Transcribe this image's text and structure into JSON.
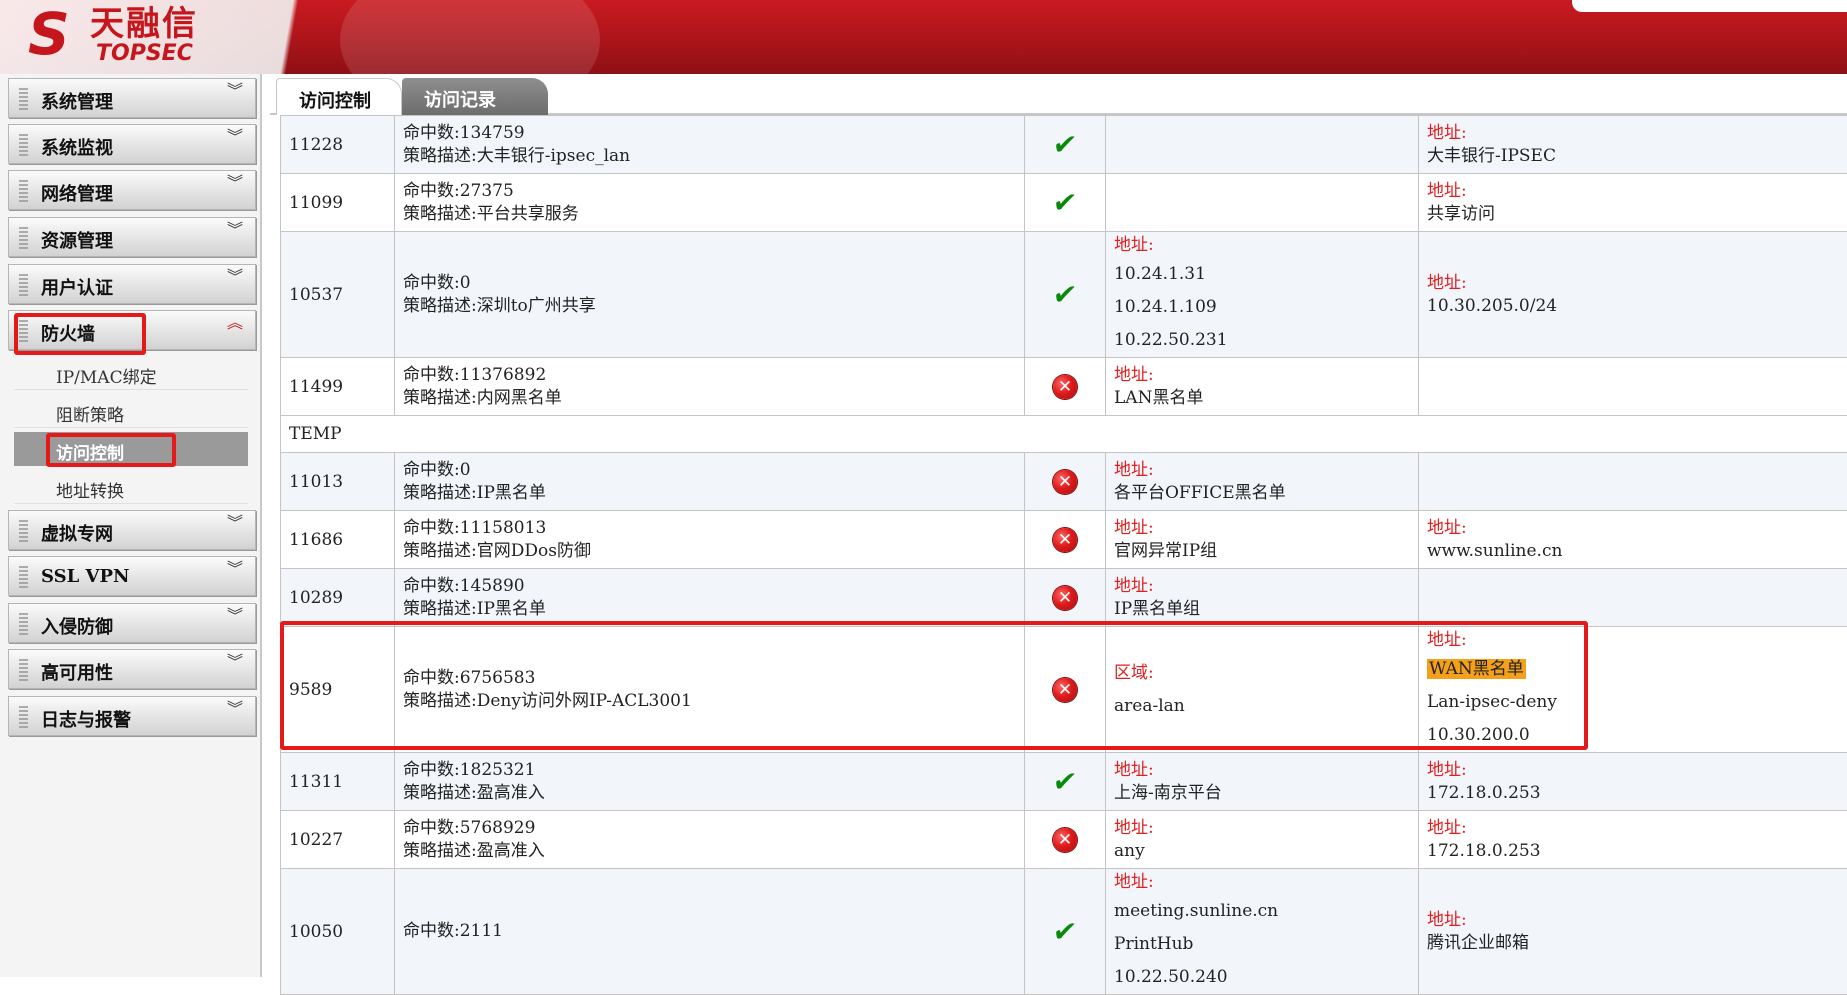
{
  "logo": {
    "mark": "S",
    "cn": "天融信",
    "en": "TOPSEC"
  },
  "sidebar": {
    "menu": [
      {
        "label": "系统管理"
      },
      {
        "label": "系统监视"
      },
      {
        "label": "网络管理"
      },
      {
        "label": "资源管理"
      },
      {
        "label": "用户认证"
      },
      {
        "label": "防火墙"
      },
      {
        "label": "虚拟专网"
      },
      {
        "label": "SSL VPN"
      },
      {
        "label": "入侵防御"
      },
      {
        "label": "高可用性"
      },
      {
        "label": "日志与报警"
      }
    ],
    "firewall_sub": [
      {
        "label": "IP/MAC绑定"
      },
      {
        "label": "阻断策略"
      },
      {
        "label": "访问控制"
      },
      {
        "label": "地址转换"
      }
    ],
    "chevron_down": "»",
    "chevron_up": "«"
  },
  "tabs": {
    "active": "访问控制",
    "inactive": "访问记录"
  },
  "labels": {
    "hits": "命中数:",
    "desc": "策略描述:",
    "addr": "地址:",
    "zone": "区域:"
  },
  "icon_colors": {
    "ok": "#0a8a0a",
    "deny": "#e01b1b"
  },
  "table": {
    "group_name": "TEMP",
    "rows_a": [
      {
        "id": "11228",
        "hits": "134759",
        "desc": "大丰银行-ipsec_lan",
        "action": "ok",
        "src": [],
        "dst": [
          "大丰银行-IPSEC"
        ]
      },
      {
        "id": "11099",
        "hits": "27375",
        "desc": "平台共享服务",
        "action": "ok",
        "src": [],
        "dst": [
          "共享访问"
        ]
      },
      {
        "id": "10537",
        "hits": "0",
        "desc": "深圳to广州共享",
        "action": "ok",
        "src": [
          "10.24.1.31",
          "10.24.1.109",
          "10.22.50.231"
        ],
        "dst": [
          "10.30.205.0/24"
        ]
      },
      {
        "id": "11499",
        "hits": "11376892",
        "desc": "内网黑名单",
        "action": "deny",
        "src": [
          "LAN黑名单"
        ],
        "dst": []
      }
    ],
    "rows_b": [
      {
        "id": "11013",
        "hits": "0",
        "desc": "IP黑名单",
        "action": "deny",
        "src": [
          "各平台OFFICE黑名单"
        ],
        "dst": []
      },
      {
        "id": "11686",
        "hits": "11158013",
        "desc": "官网DDos防御",
        "action": "deny",
        "src": [
          "官网异常IP组"
        ],
        "dst": [
          "www.sunline.cn"
        ]
      },
      {
        "id": "10289",
        "hits": "145890",
        "desc": "IP黑名单",
        "action": "deny",
        "src": [
          "IP黑名单组"
        ],
        "dst": []
      },
      {
        "id": "9589",
        "hits": "6756583",
        "desc": "Deny访问外网IP-ACL3001",
        "action": "deny",
        "src_zone": "area-lan",
        "dst": [
          "WAN黑名单",
          "Lan-ipsec-deny",
          "10.30.200.0"
        ]
      },
      {
        "id": "11311",
        "hits": "1825321",
        "desc": "盈高准入",
        "action": "ok",
        "src": [
          "上海-南京平台"
        ],
        "dst": [
          "172.18.0.253"
        ]
      },
      {
        "id": "10227",
        "hits": "5768929",
        "desc": "盈高准入",
        "action": "deny",
        "src": [
          "any"
        ],
        "dst": [
          "172.18.0.253"
        ]
      },
      {
        "id": "10050",
        "hits": "2111",
        "desc": "",
        "action": "ok",
        "src": [
          "meeting.sunline.cn",
          "PrintHub",
          "10.22.50.240"
        ],
        "dst": [
          "腾讯企业邮箱"
        ]
      }
    ]
  }
}
